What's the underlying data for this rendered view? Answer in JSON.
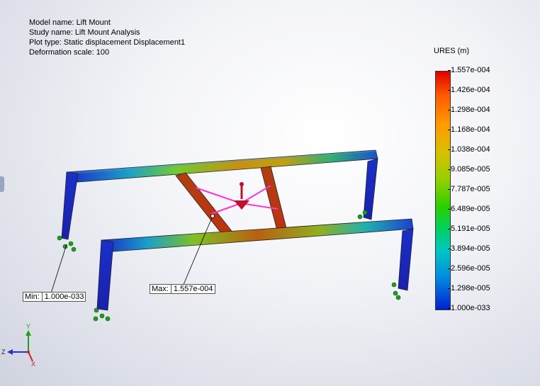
{
  "info": {
    "model_name": "Model name: Lift Mount",
    "study_name": "Study name: Lift Mount Analysis",
    "plot_type": "Plot type: Static displacement Displacement1",
    "deformation_scale": "Deformation scale: 100"
  },
  "legend": {
    "title": "URES (m)",
    "ticks": [
      "1.557e-004",
      "1.426e-004",
      "1.298e-004",
      "1.168e-004",
      "1.038e-004",
      "9.085e-005",
      "7.787e-005",
      "6.489e-005",
      "5.191e-005",
      "3.894e-005",
      "2.596e-005",
      "1.298e-005",
      "1.000e-033"
    ]
  },
  "probes": {
    "min_label": "Min:",
    "min_value": "1.000e-033",
    "max_label": "Max:",
    "max_value": "1.557e-004"
  },
  "triad": {
    "y": "Y",
    "z": "Z",
    "x": "X"
  },
  "colors": {
    "max": "#e00000",
    "min": "#0020d0",
    "fixture": "#1e9e1e",
    "load": "#ff33cc"
  }
}
